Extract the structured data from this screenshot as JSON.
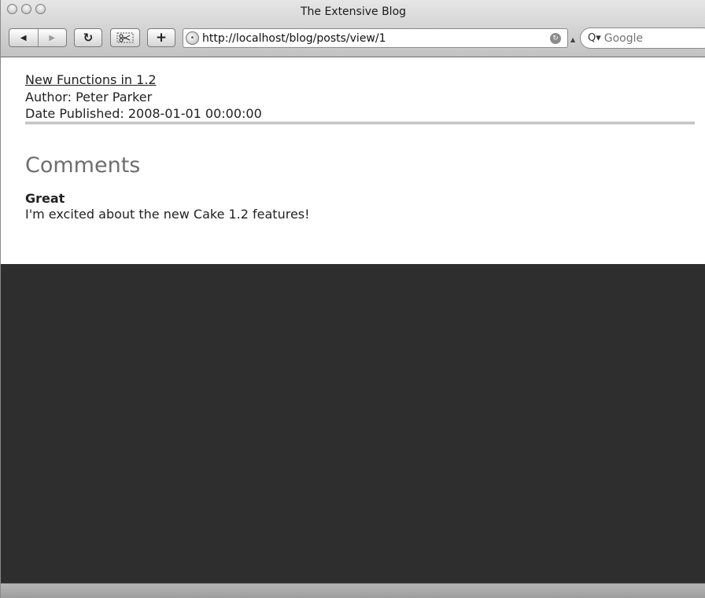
{
  "window": {
    "title": "The Extensive Blog"
  },
  "toolbar": {
    "back_icon": "◀",
    "forward_icon": "▶",
    "reload_icon": "↻",
    "add_bookmark_icon": "+",
    "address_url": "http://localhost/blog/posts/view/1",
    "search_placeholder": "Google",
    "search_icon": "Q▾"
  },
  "post": {
    "title_link": "New Functions in 1.2",
    "author": "Author: Peter Parker",
    "date_published": "Date Published: 2008-01-01 00:00:00"
  },
  "comments": {
    "heading": "Comments",
    "items": [
      {
        "title": "Great",
        "body": "I'm excited about the new Cake 1.2 features!"
      }
    ]
  },
  "colors": {
    "dark_area": "#2e2e2e",
    "heading_gray": "#6e6e6e"
  }
}
